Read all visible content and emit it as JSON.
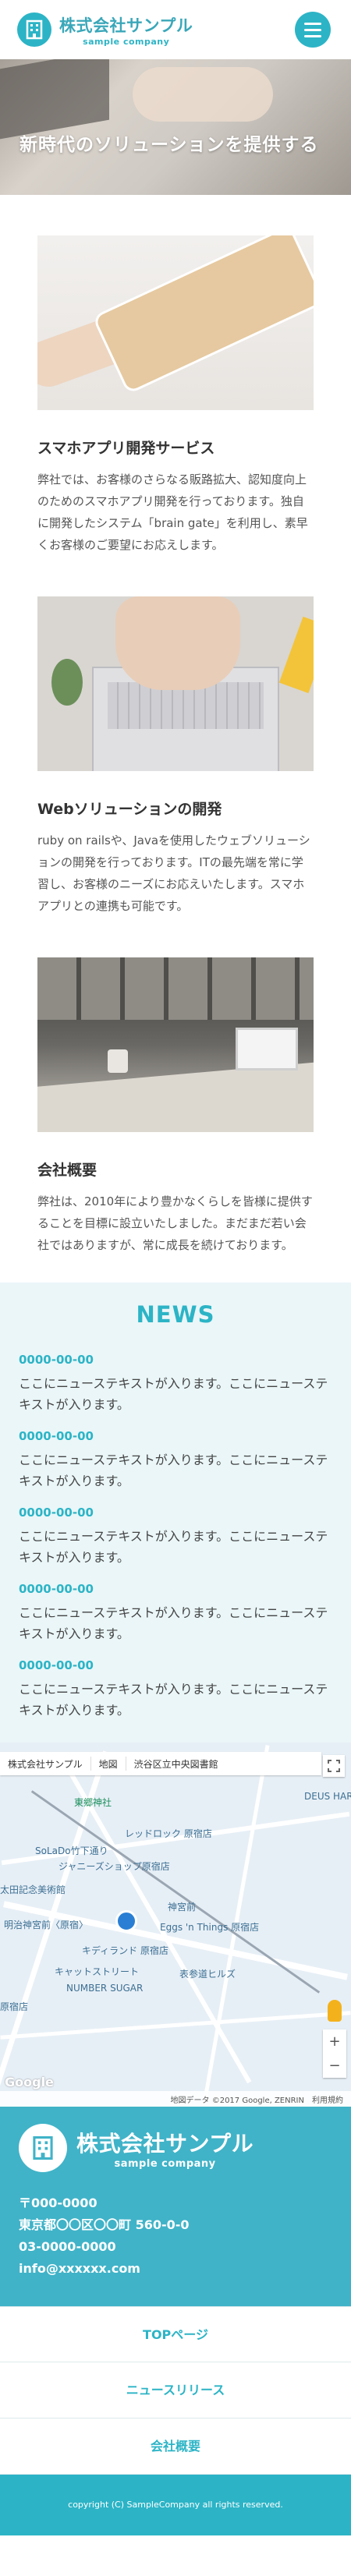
{
  "header": {
    "company_name": "株式会社サンプル",
    "company_sub": "sample company"
  },
  "hero": {
    "title": "新時代のソリューションを提供する"
  },
  "services": [
    {
      "title": "スマホアプリ開発サービス",
      "body": "弊社では、お客様のさらなる販路拡大、認知度向上のためのスマホアプリ開発を行っております。独自に開発したシステム「brain gate」を利用し、素早くお客様のご要望にお応えします。"
    },
    {
      "title": "Webソリューションの開発",
      "body": "ruby on railsや、Javaを使用したウェブソリューションの開発を行っております。ITの最先端を常に学習し、お客様のニーズにお応えいたします。スマホアプリとの連携も可能です。"
    },
    {
      "title": "会社概要",
      "body": "弊社は、2010年により豊かなくらしを皆様に提供することを目標に設立いたしました。まだまだ若い会社ではありますが、常に成長を続けております。"
    }
  ],
  "news": {
    "title": "NEWS",
    "items": [
      {
        "date": "0000-00-00",
        "text": "ここにニューステキストが入ります。ここにニューステキストが入ります。"
      },
      {
        "date": "0000-00-00",
        "text": "ここにニューステキストが入ります。ここにニューステキストが入ります。"
      },
      {
        "date": "0000-00-00",
        "text": "ここにニューステキストが入ります。ここにニューステキストが入ります。"
      },
      {
        "date": "0000-00-00",
        "text": "ここにニューステキストが入ります。ここにニューステキストが入ります。"
      },
      {
        "date": "0000-00-00",
        "text": "ここにニューステキストが入ります。ここにニューステキストが入ります。"
      }
    ]
  },
  "map": {
    "place_label": "株式会社サンプル",
    "map_tab": "地図",
    "area_label": "渋谷区立中央図書館",
    "attribution": "地図データ ©2017 Google, ZENRIN",
    "terms": "利用規約",
    "google": "Google",
    "places": [
      "東郷神社",
      "レッドロック 原宿店",
      "SoLaDo竹下通り",
      "ジャニーズショップ原宿店",
      "太田記念美術館",
      "神宮前",
      "Eggs 'n Things 原宿店",
      "キディランド 原宿店",
      "キャットストリート",
      "表参道ヒルズ",
      "NUMBER SUGAR",
      "原宿店",
      "明治神宮前〈原宿〉",
      "DEUS HARA"
    ]
  },
  "info": {
    "company_name": "株式会社サンプル",
    "company_sub": "sample company",
    "postal": "〒000-0000",
    "address": "東京都〇〇区〇〇町 560-0-0",
    "phone": "03-0000-0000",
    "email": "info@xxxxxx.com"
  },
  "footnav": [
    {
      "label": "TOPページ"
    },
    {
      "label": "ニュースリリース"
    },
    {
      "label": "会社概要"
    }
  ],
  "copyright": "copyright (C) SampleCompany all rights reserved.",
  "colors": {
    "accent": "#2cb4c6",
    "footer_bg": "#40b3c8",
    "news_bg": "#eaf6f8"
  },
  "icons": {
    "logo": "building-icon",
    "menu": "hamburger-menu-icon",
    "fullscreen": "fullscreen-icon",
    "pegman": "pegman-icon"
  }
}
